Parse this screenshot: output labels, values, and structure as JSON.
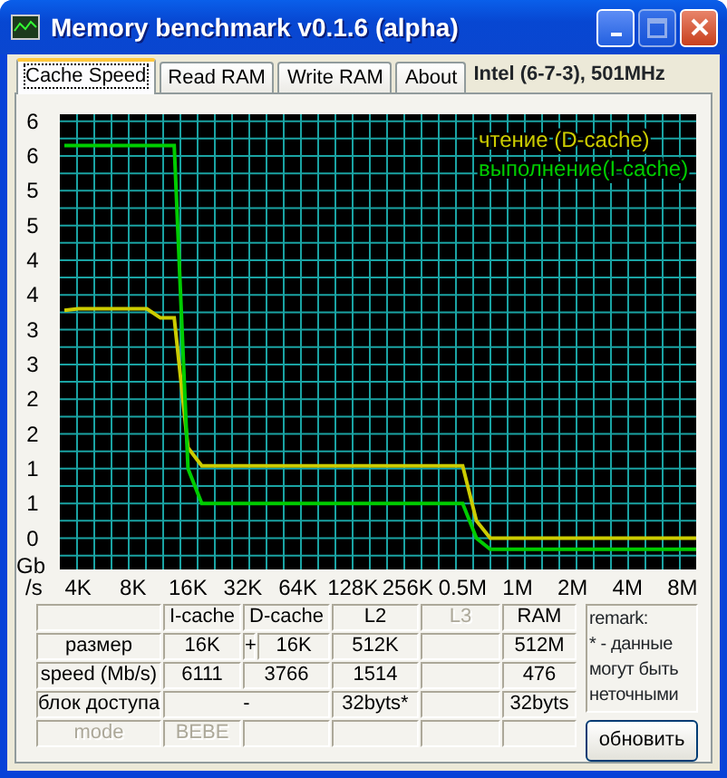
{
  "window": {
    "title": "Memory benchmark v0.1.6 (alpha)",
    "buttons": [
      {
        "kind": "minimize",
        "disabled": false
      },
      {
        "kind": "maximize",
        "disabled": true
      },
      {
        "kind": "close",
        "disabled": false
      }
    ]
  },
  "tabs": [
    {
      "label": "Cache Speed",
      "selected": true
    },
    {
      "label": "Read RAM",
      "selected": false
    },
    {
      "label": "Write RAM",
      "selected": false
    },
    {
      "label": "About",
      "selected": false
    }
  ],
  "cpu_info": "Intel (6-7-3), 501MHz",
  "chart_data": {
    "type": "line",
    "ylabel": "Gb /s",
    "grid": true,
    "categories": [
      null,
      "4K",
      null,
      null,
      null,
      "8K",
      null,
      null,
      null,
      "16K",
      null,
      null,
      null,
      "32K",
      null,
      null,
      null,
      "64K",
      null,
      null,
      null,
      "128K",
      null,
      null,
      null,
      "256K",
      null,
      null,
      null,
      "0.5M",
      null,
      null,
      null,
      "1M",
      null,
      null,
      null,
      "2M",
      null,
      null,
      null,
      "4M",
      null,
      null,
      null,
      "8M",
      null
    ],
    "series": [
      {
        "name": "чтение  (D-cache)",
        "color": "#cccc00",
        "values": [
          3.28,
          3.3,
          3.3,
          3.3,
          3.3,
          3.3,
          3.3,
          3.17,
          3.17,
          1.3,
          1.04,
          1.04,
          1.04,
          1.04,
          1.04,
          1.04,
          1.04,
          1.04,
          1.04,
          1.04,
          1.04,
          1.04,
          1.04,
          1.04,
          1.04,
          1.04,
          1.04,
          1.04,
          1.04,
          1.04,
          0.25,
          0,
          0,
          0,
          0,
          0,
          0,
          0,
          0,
          0,
          0,
          0,
          0,
          0,
          0,
          0,
          0
        ]
      },
      {
        "name": "выполнение(I-cache)",
        "color": "#00cc00",
        "values": [
          5.65,
          5.65,
          5.65,
          5.65,
          5.65,
          5.65,
          5.65,
          5.65,
          5.65,
          1.0,
          0.5,
          0.5,
          0.5,
          0.5,
          0.5,
          0.5,
          0.5,
          0.5,
          0.5,
          0.5,
          0.5,
          0.5,
          0.5,
          0.5,
          0.5,
          0.5,
          0.5,
          0.5,
          0.5,
          0.5,
          0,
          -0.16,
          -0.16,
          -0.16,
          -0.16,
          -0.16,
          -0.16,
          -0.16,
          -0.16,
          -0.16,
          -0.16,
          -0.16,
          -0.16,
          -0.16,
          -0.16,
          -0.16,
          -0.16
        ]
      }
    ],
    "ylim": [
      -0.45,
      6.1
    ],
    "yticks": [
      {
        "value": 0,
        "label": "0"
      },
      {
        "value": 0.5,
        "label": "1"
      },
      {
        "value": 1,
        "label": "1"
      },
      {
        "value": 1.5,
        "label": "2"
      },
      {
        "value": 2,
        "label": "2"
      },
      {
        "value": 2.5,
        "label": "3"
      },
      {
        "value": 3,
        "label": "3"
      },
      {
        "value": 3.5,
        "label": "4"
      },
      {
        "value": 4,
        "label": "4"
      },
      {
        "value": 4.5,
        "label": "5"
      },
      {
        "value": 5,
        "label": "5"
      },
      {
        "value": 5.5,
        "label": "6"
      },
      {
        "value": 6,
        "label": "6"
      }
    ]
  },
  "table": {
    "columns": [
      {
        "kind": "i",
        "label": "I-cache",
        "disabled": false
      },
      {
        "kind": "d-wide",
        "label": "D-cache",
        "disabled": false
      },
      {
        "kind": "l2",
        "label": "L2",
        "disabled": false
      },
      {
        "kind": "l3",
        "label": "L3",
        "disabled": true
      },
      {
        "kind": "ram",
        "label": "RAM",
        "disabled": false
      }
    ],
    "rows": [
      {
        "label": "размер",
        "disabled": false,
        "cells": [
          {
            "kind": "i",
            "text": "16K",
            "joiner": "+"
          },
          {
            "kind": "d",
            "text": "16K"
          },
          {
            "kind": "l2",
            "text": "512K"
          },
          {
            "kind": "l3"
          },
          {
            "kind": "ram",
            "text": "512M"
          }
        ]
      },
      {
        "label": "speed (Mb/s)",
        "disabled": false,
        "cells": [
          {
            "kind": "i",
            "text": "6111"
          },
          {
            "kind": "d-wide",
            "text": "3766"
          },
          {
            "kind": "l2",
            "text": "1514"
          },
          {
            "kind": "l3"
          },
          {
            "kind": "ram",
            "text": "476"
          }
        ]
      },
      {
        "label": "блок доступа",
        "disabled": false,
        "cells": [
          {
            "kind": "merged",
            "text": "-"
          },
          {
            "kind": "covered"
          },
          {
            "kind": "l2",
            "text": "32byts*"
          },
          {
            "kind": "l3"
          },
          {
            "kind": "ram",
            "text": "32byts"
          }
        ]
      },
      {
        "label": "mode",
        "disabled": true,
        "cells": [
          {
            "kind": "i",
            "text": "BEBE"
          },
          {
            "kind": "d-wide"
          },
          {
            "kind": "l2"
          },
          {
            "kind": "l3"
          },
          {
            "kind": "ram"
          }
        ]
      }
    ]
  },
  "remark": {
    "title": "remark:",
    "text": "* - данные могут быть неточными"
  },
  "refresh_button": "обновить"
}
